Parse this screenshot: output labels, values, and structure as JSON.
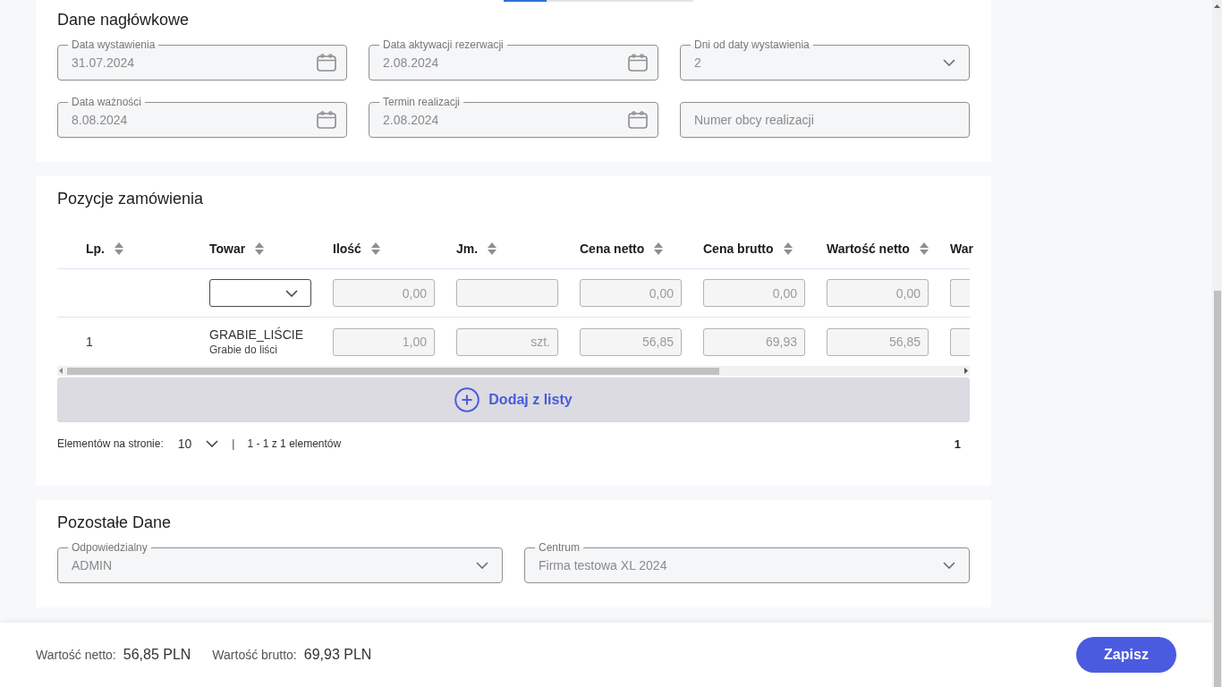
{
  "header_section": {
    "title": "Dane nagłówkowe",
    "fields": [
      {
        "kind": "date",
        "label": "Data wystawienia",
        "value": "31.07.2024",
        "disabled": true
      },
      {
        "kind": "date",
        "label": "Data aktywacji rezerwacji",
        "value": "2.08.2024",
        "disabled": true
      },
      {
        "kind": "select",
        "label": "Dni od daty wystawienia",
        "value": "2",
        "disabled": true
      },
      {
        "kind": "date",
        "label": "Data ważności",
        "value": "8.08.2024",
        "disabled": true
      },
      {
        "kind": "date",
        "label": "Termin realizacji",
        "value": "2.08.2024",
        "disabled": true
      },
      {
        "kind": "text",
        "placeholder": "Numer obcy realizacji"
      }
    ]
  },
  "items_section": {
    "title": "Pozycje zamówienia",
    "table": {
      "columns": [
        {
          "label": "Lp.",
          "sortable": true
        },
        {
          "label": "Towar",
          "sortable": true
        },
        {
          "label": "Ilość",
          "sortable": true
        },
        {
          "label": "Jm.",
          "sortable": true
        },
        {
          "label": "Cena netto",
          "sortable": true
        },
        {
          "label": "Cena brutto",
          "sortable": true
        },
        {
          "label": "Wartość netto",
          "sortable": true
        },
        {
          "label": "War",
          "sortable": false
        }
      ],
      "rows": [
        {
          "cells": [
            {
              "kind": "blank"
            },
            {
              "kind": "select",
              "disabled": false
            },
            {
              "kind": "field",
              "value": "0,00",
              "disabled": true
            },
            {
              "kind": "field",
              "disabled": true
            },
            {
              "kind": "field",
              "value": "0,00",
              "disabled": true
            },
            {
              "kind": "field",
              "value": "0,00",
              "disabled": true
            },
            {
              "kind": "field",
              "value": "0,00",
              "disabled": true
            },
            {
              "kind": "field_cut",
              "disabled": true
            }
          ]
        },
        {
          "cells": [
            {
              "kind": "text",
              "value": "1"
            },
            {
              "kind": "product",
              "code": "GRABIE_LIŚCIE",
              "name": "Grabie do liści"
            },
            {
              "kind": "field",
              "value": "1,00",
              "disabled": true
            },
            {
              "kind": "field",
              "value": "szt.",
              "disabled": true
            },
            {
              "kind": "field",
              "value": "56,85",
              "disabled": true
            },
            {
              "kind": "field",
              "value": "69,93",
              "disabled": true
            },
            {
              "kind": "field",
              "value": "56,85",
              "disabled": true
            },
            {
              "kind": "field_cut",
              "disabled": true
            }
          ]
        }
      ]
    },
    "add_button": {
      "label": "Dodaj z listy"
    },
    "pagination": {
      "per_page_label": "Elementów na stronie:",
      "per_page": "10",
      "separator": "|",
      "range": "1 - 1 z 1 elementów",
      "page": "1"
    }
  },
  "other_section": {
    "title": "Pozostałe Dane",
    "fields": [
      {
        "kind": "select",
        "label": "Odpowiedzialny",
        "value": "ADMIN",
        "disabled": true
      },
      {
        "kind": "select",
        "label": "Centrum",
        "value": "Firma testowa XL 2024",
        "disabled": true
      }
    ]
  },
  "footer": {
    "totals": [
      {
        "label": "Wartość netto:",
        "value": "56,85 PLN"
      },
      {
        "label": "Wartość brutto:",
        "value": "69,93 PLN"
      }
    ],
    "save_button": "Zapisz"
  }
}
